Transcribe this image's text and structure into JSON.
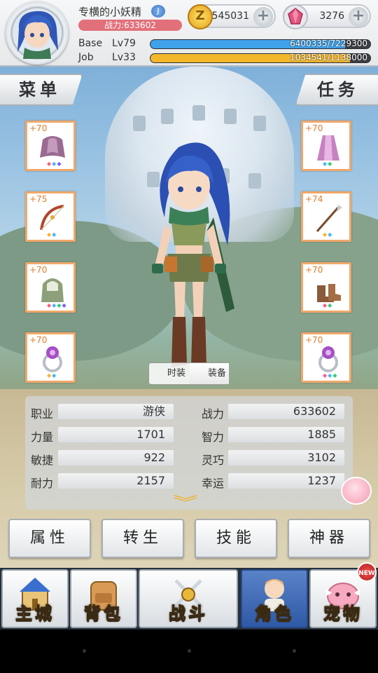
{
  "player": {
    "name": "专横的小妖精",
    "badge_text": "J",
    "power_label": "战力:633602"
  },
  "currency": {
    "zeny_value": "545031",
    "gem_value": "3276",
    "plus_symbol": "+",
    "zeny_symbol": "Z"
  },
  "levels": {
    "base_label": "Base",
    "base_level": "Lv79",
    "base_exp_text": "6400335/7229300",
    "base_exp_fraction": 0.885,
    "base_bar_color": "#3fa2ea",
    "job_label": "Job",
    "job_level": "Lv33",
    "job_exp_text": "1034541/1138000",
    "job_exp_fraction": 0.909,
    "job_bar_color": "#f2b72b"
  },
  "side_tabs": {
    "menu_label": "菜单",
    "quest_label": "任务"
  },
  "equipment": {
    "left": [
      {
        "plus": "+70",
        "icon": "mantle-icon",
        "gems": [
          "#ff5b8a",
          "#46b6ff",
          "#7b5cff"
        ]
      },
      {
        "plus": "+75",
        "icon": "bow-icon",
        "gems": [
          "#ffb12a",
          "#46b6ff"
        ]
      },
      {
        "plus": "+70",
        "icon": "hood-armor-icon",
        "gems": [
          "#ff5b8a",
          "#46b6ff",
          "#2ecf7a",
          "#7b5cff"
        ]
      },
      {
        "plus": "+70",
        "icon": "ring-icon",
        "gems": [
          "#ffb12a",
          "#46b6ff"
        ]
      }
    ],
    "right": [
      {
        "plus": "+70",
        "icon": "robe-icon",
        "gems": [
          "#46b6ff",
          "#2ecf7a"
        ]
      },
      {
        "plus": "+74",
        "icon": "spear-icon",
        "gems": [
          "#ffb12a",
          "#46b6ff"
        ]
      },
      {
        "plus": "+70",
        "icon": "boots-icon",
        "gems": [
          "#ff5b8a",
          "#2ecf7a"
        ]
      },
      {
        "plus": "+70",
        "icon": "ring-icon",
        "gems": [
          "#ff5b8a",
          "#46b6ff",
          "#2ecf7a"
        ]
      }
    ]
  },
  "view_toggle": {
    "fashion_label": "时装",
    "equip_label": "装备"
  },
  "stats": {
    "rows": [
      {
        "l_label": "职业",
        "l_value": "游侠",
        "r_label": "战力",
        "r_value": "633602"
      },
      {
        "l_label": "力量",
        "l_value": "1701",
        "r_label": "智力",
        "r_value": "1885"
      },
      {
        "l_label": "敏捷",
        "l_value": "922",
        "r_label": "灵巧",
        "r_value": "3102"
      },
      {
        "l_label": "耐力",
        "l_value": "2157",
        "r_label": "幸运",
        "r_value": "1237"
      }
    ],
    "expand_icon": "chevron-down-icon"
  },
  "actions": {
    "attributes": "属性",
    "rebirth": "转生",
    "skills": "技能",
    "artifact": "神器"
  },
  "nav": {
    "items": [
      {
        "label": "主城",
        "icon": "castle-icon"
      },
      {
        "label": "背包",
        "icon": "backpack-icon"
      },
      {
        "label": "战斗",
        "icon": "crossed-swords-icon"
      },
      {
        "label": "角色",
        "icon": "character-icon"
      },
      {
        "label": "宠物",
        "icon": "pet-icon"
      }
    ],
    "new_badge": "NEW"
  },
  "colors": {
    "slot_border": "#f0a86a",
    "active_nav": "#3b66b4",
    "plus_text": "#e07b2a"
  }
}
